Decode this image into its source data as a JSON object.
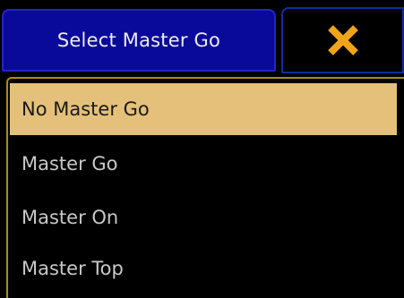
{
  "dialog": {
    "title": "Select Master Go",
    "close_icon": "close-x-icon",
    "accent_color": "#f0a41a",
    "title_bg_color": "#0a0a9a",
    "selected_bg_color": "#e4c07a"
  },
  "options": [
    {
      "label": "No Master Go",
      "selected": true
    },
    {
      "label": "Master Go",
      "selected": false
    },
    {
      "label": "Master On",
      "selected": false
    },
    {
      "label": "Master Top",
      "selected": false
    }
  ]
}
